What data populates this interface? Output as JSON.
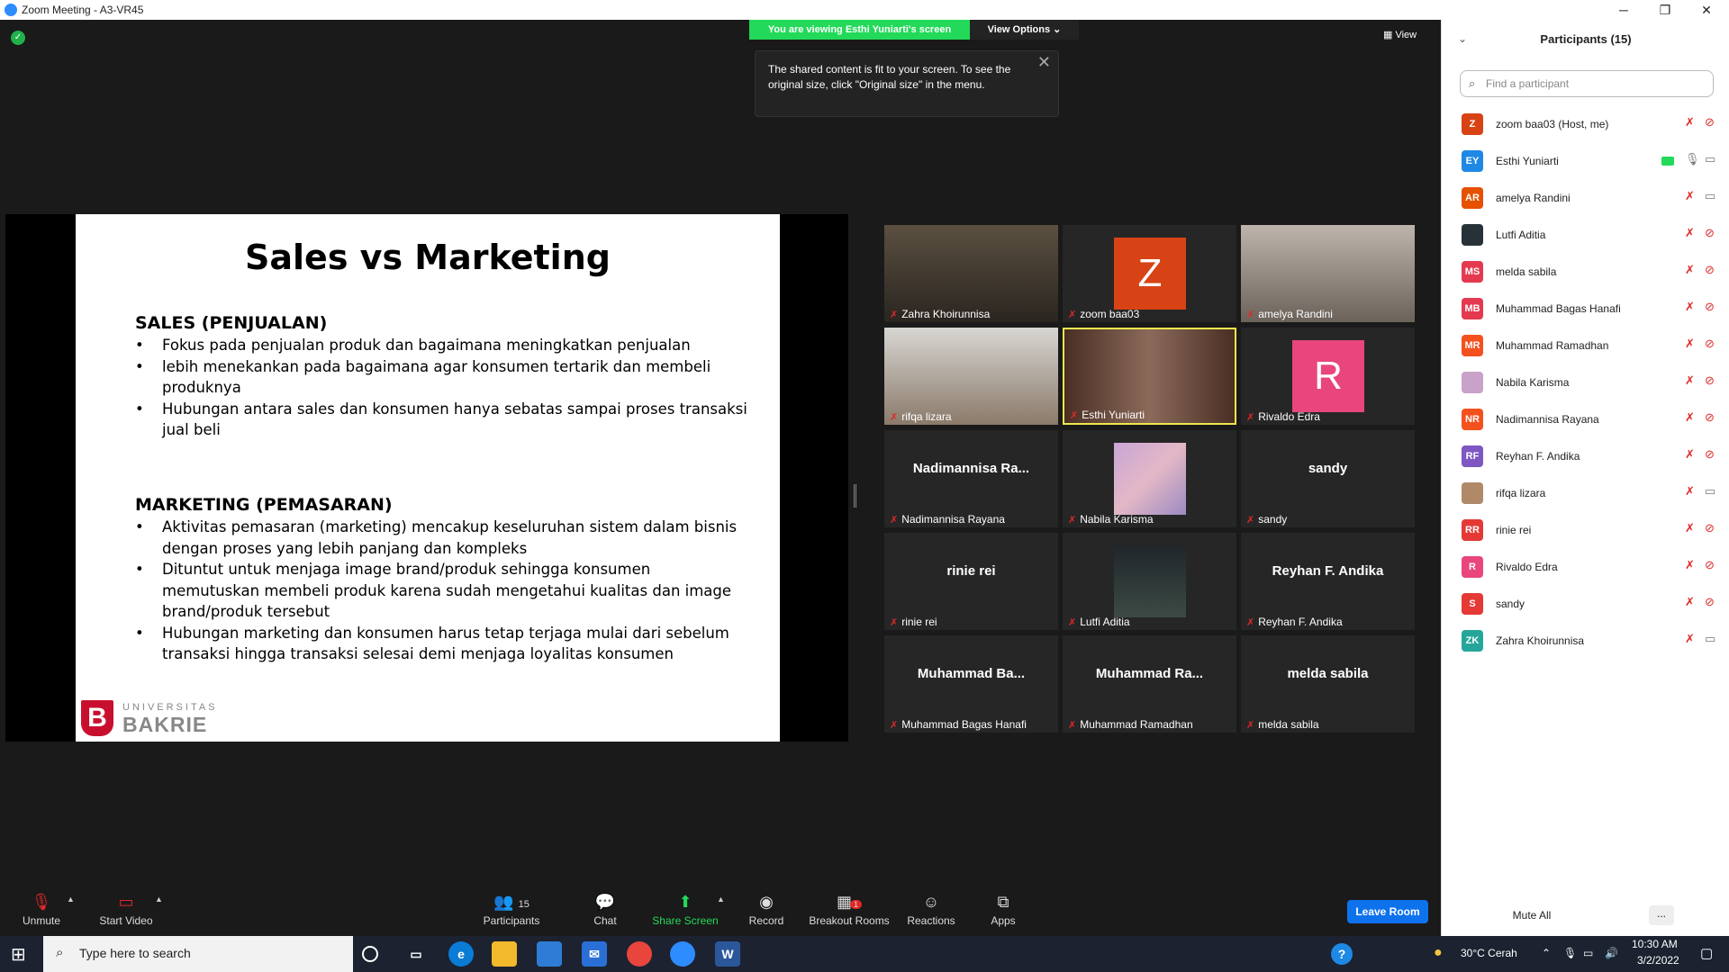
{
  "window": {
    "title": "Zoom Meeting - A3-VR45",
    "min": "─",
    "max": "❐",
    "close": "✕"
  },
  "banner": {
    "viewing": "You are viewing Esthi Yuniarti's screen",
    "view_options": "View Options ⌄"
  },
  "tooltip": {
    "text": "The shared content is fit to your screen. To see the original size, click \"Original size\" in the menu.",
    "close": "✕"
  },
  "view_button": "▦ View",
  "slide": {
    "title": "Sales vs Marketing",
    "sales_heading": "SALES (PENJUALAN)",
    "sales_points": [
      "Fokus pada penjualan produk dan bagaimana meningkatkan penjualan",
      "lebih menekankan pada bagaimana agar konsumen tertarik dan membeli produknya",
      "Hubungan antara sales dan konsumen hanya sebatas sampai proses transaksi jual beli"
    ],
    "marketing_heading": "MARKETING (PEMASARAN)",
    "marketing_points": [
      "Aktivitas pemasaran (marketing) mencakup keseluruhan sistem dalam bisnis dengan proses yang lebih panjang dan kompleks",
      "Dituntut untuk menjaga image brand/produk sehingga konsumen memutuskan membeli produk karena sudah mengetahui kualitas dan image brand/produk tersebut",
      "Hubungan marketing dan konsumen harus tetap terjaga  mulai dari sebelum transaksi hingga transaksi selesai demi menjaga loyalitas konsumen"
    ],
    "logo_small": "UNIVERSITAS",
    "logo_big": "BAKRIE",
    "logo_letter": "B"
  },
  "tiles": [
    {
      "label": "Zahra Khoirunnisa",
      "kind": "video",
      "center": ""
    },
    {
      "label": "zoom baa03",
      "kind": "avatar",
      "center": "Z",
      "color": "#d84315"
    },
    {
      "label": "amelya Randini",
      "kind": "video",
      "center": ""
    },
    {
      "label": "rifqa lizara",
      "kind": "video",
      "center": ""
    },
    {
      "label": "Esthi Yuniarti",
      "kind": "video",
      "center": ""
    },
    {
      "label": "Rivaldo Edra",
      "kind": "avatar",
      "center": "R",
      "color": "#e8467c"
    },
    {
      "label": "Nadimannisa Rayana",
      "kind": "name",
      "center": "Nadimannisa  Ra..."
    },
    {
      "label": "Nabila Karisma",
      "kind": "image",
      "center": ""
    },
    {
      "label": "sandy",
      "kind": "name",
      "center": "sandy"
    },
    {
      "label": "rinie rei",
      "kind": "name",
      "center": "rinie rei"
    },
    {
      "label": "Lutfi Aditia",
      "kind": "image",
      "center": ""
    },
    {
      "label": "Reyhan F. Andika",
      "kind": "name",
      "center": "Reyhan F. Andika"
    },
    {
      "label": "Muhammad Bagas Hanafi",
      "kind": "name",
      "center": "Muhammad  Ba..."
    },
    {
      "label": "Muhammad Ramadhan",
      "kind": "name",
      "center": "Muhammad  Ra..."
    },
    {
      "label": "melda sabila",
      "kind": "name",
      "center": "melda sabila"
    }
  ],
  "toolbar": {
    "unmute": "Unmute",
    "start_video": "Start Video",
    "participants": "Participants",
    "participants_count": "15",
    "chat": "Chat",
    "share_screen": "Share Screen",
    "record": "Record",
    "breakout": "Breakout Rooms",
    "breakout_badge": "1",
    "reactions": "Reactions",
    "apps": "Apps",
    "leave": "Leave Room"
  },
  "panel": {
    "title": "Participants (15)",
    "search_placeholder": "Find a participant",
    "mute_all": "Mute All",
    "more": "...",
    "people": [
      {
        "initials": "Z",
        "name": "zoom baa03 (Host, me)",
        "color": "#d84315",
        "mic": "off",
        "cam": "off"
      },
      {
        "initials": "EY",
        "name": "Esthi Yuniarti",
        "color": "#1e88e5",
        "mic": "on",
        "cam": "on",
        "sharing": true
      },
      {
        "initials": "AR",
        "name": "amelya Randini",
        "color": "#e65100",
        "mic": "off",
        "cam": "on"
      },
      {
        "initials": "",
        "name": "Lutfi Aditia",
        "color": "#263238",
        "mic": "off",
        "cam": "off"
      },
      {
        "initials": "MS",
        "name": "melda sabila",
        "color": "#e53950",
        "mic": "off",
        "cam": "off"
      },
      {
        "initials": "MB",
        "name": "Muhammad Bagas Hanafi",
        "color": "#e53950",
        "mic": "off",
        "cam": "off"
      },
      {
        "initials": "MR",
        "name": "Muhammad Ramadhan",
        "color": "#f4511e",
        "mic": "off",
        "cam": "off"
      },
      {
        "initials": "",
        "name": "Nabila Karisma",
        "color": "#c8a2c8",
        "mic": "off",
        "cam": "off"
      },
      {
        "initials": "NR",
        "name": "Nadimannisa Rayana",
        "color": "#f4511e",
        "mic": "off",
        "cam": "off"
      },
      {
        "initials": "RF",
        "name": "Reyhan F. Andika",
        "color": "#7e57c2",
        "mic": "off",
        "cam": "off"
      },
      {
        "initials": "",
        "name": "rifqa lizara",
        "color": "#b08968",
        "mic": "off",
        "cam": "on"
      },
      {
        "initials": "RR",
        "name": "rinie rei",
        "color": "#e53935",
        "mic": "off",
        "cam": "off"
      },
      {
        "initials": "R",
        "name": "Rivaldo Edra",
        "color": "#e8467c",
        "mic": "off",
        "cam": "off"
      },
      {
        "initials": "S",
        "name": "sandy",
        "color": "#e53935",
        "mic": "off",
        "cam": "off"
      },
      {
        "initials": "ZK",
        "name": "Zahra Khoirunnisa",
        "color": "#26a69a",
        "mic": "off",
        "cam": "on"
      }
    ]
  },
  "taskbar": {
    "search": "Type here to search",
    "weather": "30°C  Cerah",
    "time": "10:30 AM",
    "date": "3/2/2022",
    "word": "W",
    "start": "⊞",
    "help": "?"
  }
}
